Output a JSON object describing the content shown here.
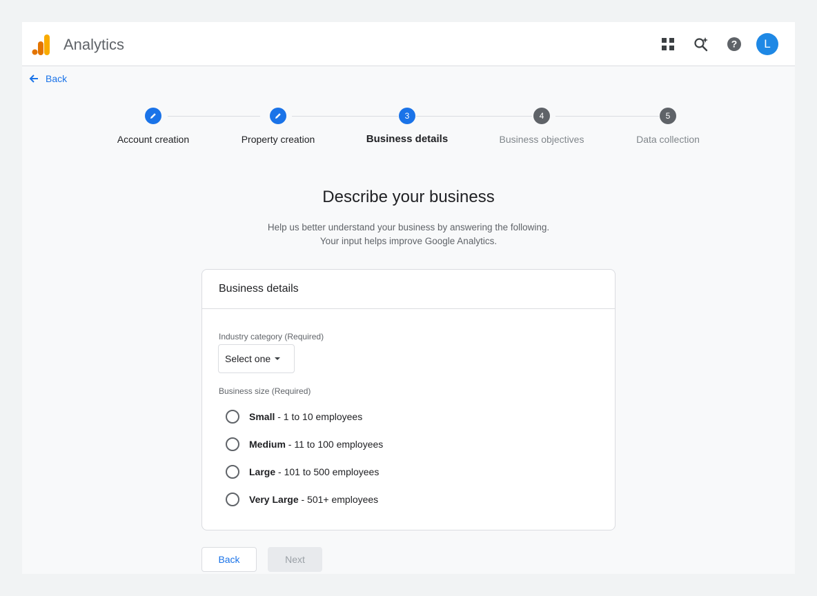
{
  "header": {
    "app_title": "Analytics",
    "icons": [
      "apps-grid-icon",
      "search-insights-icon",
      "help-icon"
    ],
    "avatar_initial": "L",
    "avatar_color": "#1e88e5"
  },
  "nav": {
    "back_label": "Back"
  },
  "stepper": {
    "steps": [
      {
        "number": "1",
        "label": "Account creation",
        "state": "done"
      },
      {
        "number": "2",
        "label": "Property creation",
        "state": "done"
      },
      {
        "number": "3",
        "label": "Business details",
        "state": "active"
      },
      {
        "number": "4",
        "label": "Business objectives",
        "state": "todo"
      },
      {
        "number": "5",
        "label": "Data collection",
        "state": "todo"
      }
    ]
  },
  "main": {
    "headline": "Describe your business",
    "subtext_line1": "Help us better understand your business by answering the following.",
    "subtext_line2": "Your input helps improve Google Analytics."
  },
  "card": {
    "title": "Business details",
    "industry_label": "Industry category (Required)",
    "industry_value": "Select one",
    "size_label": "Business size (Required)",
    "size_options": [
      {
        "name": "Small",
        "detail": " - 1 to 10 employees"
      },
      {
        "name": "Medium",
        "detail": " - 11 to 100 employees"
      },
      {
        "name": "Large",
        "detail": " - 101 to 500 employees"
      },
      {
        "name": "Very Large",
        "detail": " - 501+ employees"
      }
    ]
  },
  "footer": {
    "back_button": "Back",
    "next_button": "Next"
  },
  "colors": {
    "accent": "#1a73e8",
    "logo_orange": "#f9ab00",
    "logo_dark": "#e37400"
  }
}
